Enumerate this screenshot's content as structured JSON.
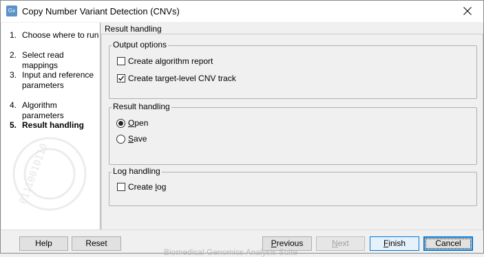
{
  "window": {
    "title": "Copy Number Variant Detection (CNVs)",
    "app_icon_text": "Gx"
  },
  "steps": [
    {
      "num": "1.",
      "label": "Choose where to run",
      "active": false
    },
    {
      "num": "2.",
      "label": "Select read mappings",
      "active": false
    },
    {
      "num": "3.",
      "label": "Input and reference parameters",
      "active": false
    },
    {
      "num": "4.",
      "label": "Algorithm parameters",
      "active": false
    },
    {
      "num": "5.",
      "label": "Result handling",
      "active": true
    }
  ],
  "pane": {
    "title": "Result handling",
    "output_options": {
      "title": "Output options",
      "algorithm_report": {
        "label": "Create algorithm report",
        "checked": false
      },
      "cnv_track": {
        "label": "Create target-level CNV track",
        "checked": true
      }
    },
    "result_handling": {
      "title": "Result handling",
      "open": {
        "label_u": "O",
        "label_rest": "pen",
        "selected": true
      },
      "save": {
        "label_u": "S",
        "label_rest": "ave",
        "selected": false
      }
    },
    "log_handling": {
      "title": "Log handling",
      "create_log": {
        "label_pre": "Create ",
        "label_u": "l",
        "label_rest": "og",
        "checked": false
      }
    }
  },
  "buttons": {
    "help": "Help",
    "reset": "Reset",
    "previous_u": "P",
    "previous_rest": "revious",
    "next_u": "N",
    "next_rest": "ext",
    "finish_u": "F",
    "finish_rest": "inish",
    "cancel": "Cancel"
  },
  "background_text": "Biomedical Genomics Analysis Suite"
}
